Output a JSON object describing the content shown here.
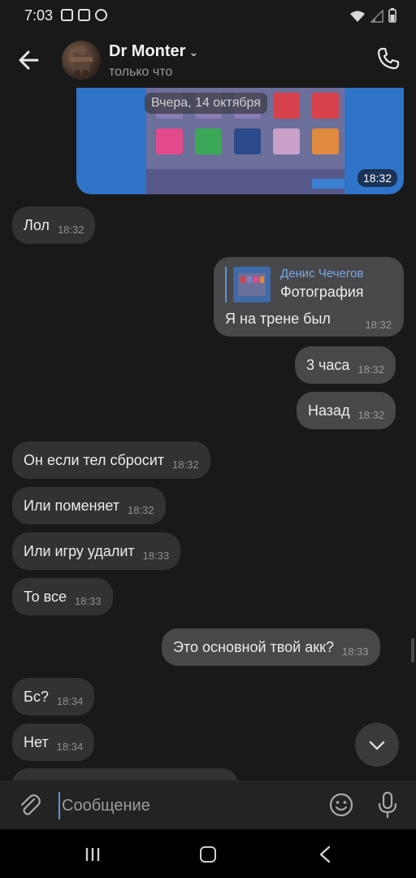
{
  "status_bar": {
    "time": "7:03"
  },
  "header": {
    "title": "Dr Monter",
    "subtitle": "только что"
  },
  "image_message": {
    "date": "Вчера, 14 октября",
    "time": "18:32"
  },
  "messages": [
    {
      "text": "Лол",
      "time": "18:32",
      "dir": "in"
    },
    {
      "text": "3 часа",
      "time": "18:32",
      "dir": "out"
    },
    {
      "text": "Назад",
      "time": "18:32",
      "dir": "out"
    },
    {
      "text": "Он если тел сбросит",
      "time": "18:32",
      "dir": "in"
    },
    {
      "text": "Или поменяет",
      "time": "18:32",
      "dir": "in"
    },
    {
      "text": "Или игру удалит",
      "time": "18:33",
      "dir": "in"
    },
    {
      "text": "То все",
      "time": "18:33",
      "dir": "in"
    },
    {
      "text": "Это основной твой акк?",
      "time": "18:33",
      "dir": "out"
    },
    {
      "text": "Бс?",
      "time": "18:34",
      "dir": "in"
    },
    {
      "text": "Нет",
      "time": "18:34",
      "dir": "in"
    }
  ],
  "reply_message": {
    "quote_author": "Денис Чечегов",
    "quote_type": "Фотография",
    "text": "Я на трене был",
    "time": "18:32"
  },
  "input": {
    "placeholder": "Сообщение"
  },
  "colors": {
    "accent": "#5b93d8",
    "background": "#19191a",
    "incoming": "#323233",
    "outgoing": "#48484a"
  }
}
